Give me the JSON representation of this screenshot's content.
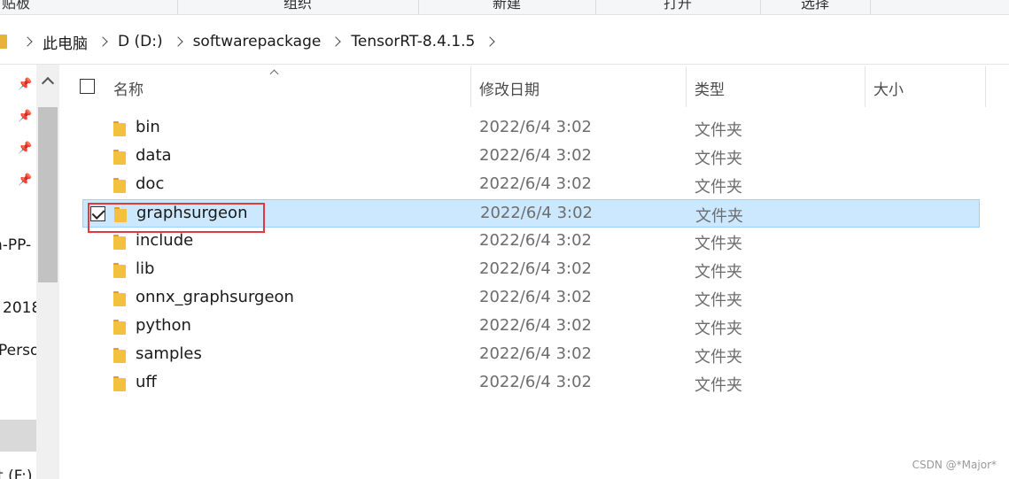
{
  "ribbon": {
    "groups": [
      "剪贴板",
      "组织",
      "新建",
      "打开",
      "选择"
    ]
  },
  "address_bar": {
    "crumbs": [
      "此电脑",
      "D (D:)",
      "softwarepackage",
      "TensorRT-8.4.1.5"
    ]
  },
  "nav_pane": {
    "items": [
      "n-PP-",
      "2018",
      "Perso",
      "t (F:)"
    ]
  },
  "columns": {
    "name": "名称",
    "date_modified": "修改日期",
    "type": "类型",
    "size": "大小"
  },
  "files": [
    {
      "name": "bin",
      "date": "2022/6/4 3:02",
      "type": "文件夹",
      "selected": false
    },
    {
      "name": "data",
      "date": "2022/6/4 3:02",
      "type": "文件夹",
      "selected": false
    },
    {
      "name": "doc",
      "date": "2022/6/4 3:02",
      "type": "文件夹",
      "selected": false
    },
    {
      "name": "graphsurgeon",
      "date": "2022/6/4 3:02",
      "type": "文件夹",
      "selected": true
    },
    {
      "name": "include",
      "date": "2022/6/4 3:02",
      "type": "文件夹",
      "selected": false
    },
    {
      "name": "lib",
      "date": "2022/6/4 3:02",
      "type": "文件夹",
      "selected": false
    },
    {
      "name": "onnx_graphsurgeon",
      "date": "2022/6/4 3:02",
      "type": "文件夹",
      "selected": false
    },
    {
      "name": "python",
      "date": "2022/6/4 3:02",
      "type": "文件夹",
      "selected": false
    },
    {
      "name": "samples",
      "date": "2022/6/4 3:02",
      "type": "文件夹",
      "selected": false
    },
    {
      "name": "uff",
      "date": "2022/6/4 3:02",
      "type": "文件夹",
      "selected": false
    }
  ],
  "watermark": "CSDN @*Major*",
  "colors": {
    "selection_bg": "#cce8ff",
    "selection_border": "#99d1ff",
    "highlight_box": "#e53935",
    "folder": "#f3c13d"
  },
  "icons": {
    "folder": "folder-icon",
    "pin": "pin-icon",
    "chevron": "chevron-right-icon",
    "sort": "sort-up-icon",
    "checkbox": "checkbox-icon"
  }
}
